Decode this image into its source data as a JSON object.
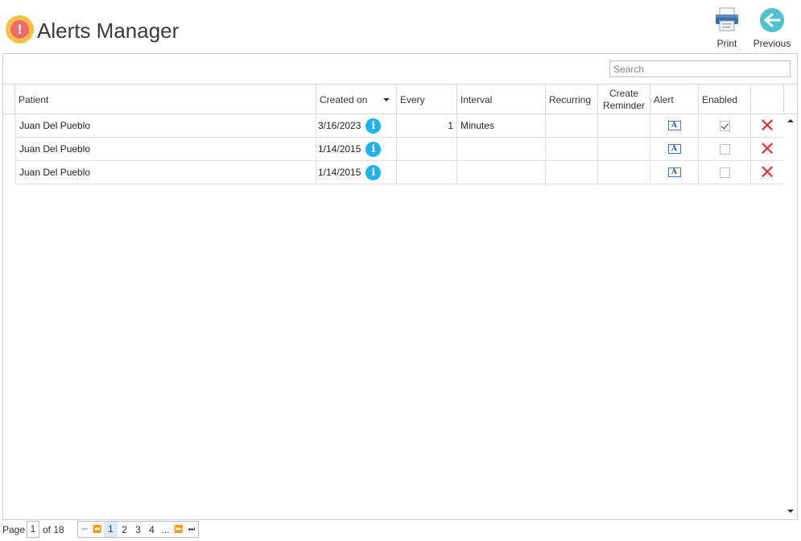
{
  "header": {
    "title": "Alerts Manager",
    "print_label": "Print",
    "previous_label": "Previous"
  },
  "search": {
    "placeholder": "Search"
  },
  "columns": {
    "patient": "Patient",
    "created_on": "Created on",
    "every": "Every",
    "interval": "Interval",
    "recurring": "Recurring",
    "create_reminder": "Create Reminder",
    "alert": "Alert",
    "enabled": "Enabled"
  },
  "rows": [
    {
      "patient": "Juan Del Pueblo",
      "created_on": "3/16/2023",
      "every": "1",
      "interval": "Minutes",
      "recurring": "",
      "create_reminder": "",
      "enabled": true
    },
    {
      "patient": "Juan Del Pueblo",
      "created_on": "1/14/2015",
      "every": "",
      "interval": "",
      "recurring": "",
      "create_reminder": "",
      "enabled": false
    },
    {
      "patient": "Juan Del Pueblo",
      "created_on": "1/14/2015",
      "every": "",
      "interval": "",
      "recurring": "",
      "create_reminder": "",
      "enabled": false
    }
  ],
  "pager": {
    "page_label": "Page",
    "current_page": "1",
    "of_label": "of 18",
    "pages": [
      "1",
      "2",
      "3",
      "4"
    ],
    "ellipsis": "..."
  },
  "icons": {
    "logo": "alert-exclamation-icon",
    "print": "printer-icon",
    "previous": "back-arrow-icon",
    "info": "info-icon",
    "alert": "alert-text-icon",
    "delete": "delete-x-icon"
  },
  "colors": {
    "logo_outer": "#f6c042",
    "logo_inner": "#ef6b6b",
    "info": "#1fb3ee",
    "delete": "#e83838",
    "previous": "#4fc1cf"
  }
}
